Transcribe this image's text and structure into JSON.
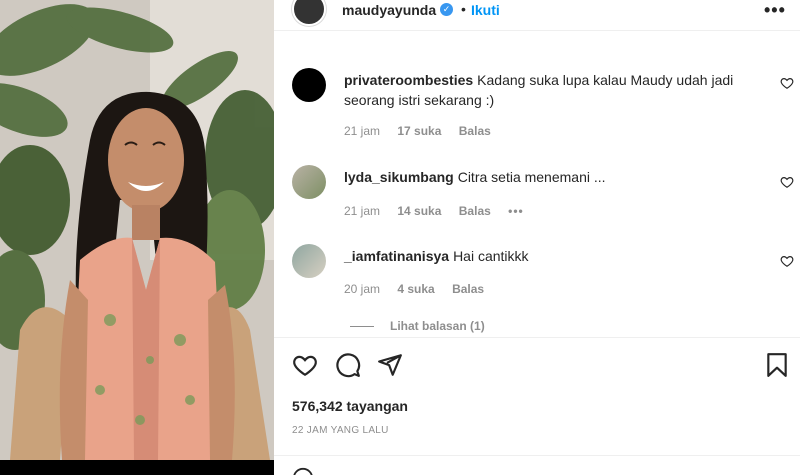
{
  "post": {
    "username": "maudyayunda",
    "separator": "•",
    "follow_label": "Ikuti",
    "more_label": "•••"
  },
  "comments": [
    {
      "username": "privateroombesties",
      "text": "Kadang suka lupa kalau Maudy udah jadi seorang istri sekarang :)",
      "time": "21 jam",
      "likes": "17 suka",
      "reply_label": "Balas",
      "more_label": ""
    },
    {
      "username": "lyda_sikumbang",
      "text": "Citra setia menemani ...",
      "time": "21 jam",
      "likes": "14 suka",
      "reply_label": "Balas",
      "more_label": "•••"
    },
    {
      "username": "_iamfatinanisya",
      "text": "Hai cantikkk",
      "time": "20 jam",
      "likes": "4 suka",
      "reply_label": "Balas",
      "more_label": ""
    }
  ],
  "view_replies_label": "Lihat balasan (1)",
  "stats": {
    "views": "576,342 tayangan",
    "timestamp": "22 JAM YANG LALU"
  },
  "icons": {
    "verified": "verified-badge-icon",
    "like": "heart-icon",
    "comment": "comment-icon",
    "share": "share-icon",
    "save": "bookmark-icon",
    "emoji": "emoji-icon"
  },
  "colors": {
    "accent": "#0095f6",
    "verified": "#3897f0",
    "muted": "#8e8e8e",
    "text": "#262626"
  }
}
